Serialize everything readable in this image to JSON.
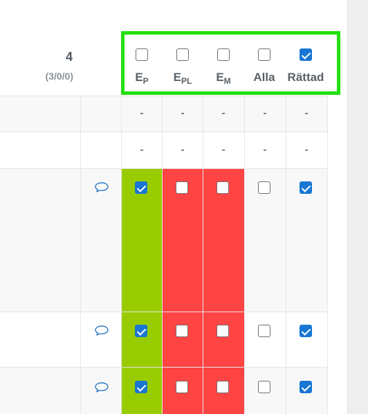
{
  "summary": {
    "count": "4",
    "detail": "(3/0/0)"
  },
  "header": {
    "columns": [
      {
        "base": "E",
        "sub": "P",
        "checked": false
      },
      {
        "base": "E",
        "sub": "PL",
        "checked": false
      },
      {
        "base": "E",
        "sub": "M",
        "checked": false
      },
      {
        "base": "Alla",
        "sub": "",
        "checked": false
      },
      {
        "base": "Rättad",
        "sub": "",
        "checked": true
      }
    ]
  },
  "dash_rows": [
    [
      "-",
      "-",
      "-",
      "-",
      "-"
    ],
    [
      "-",
      "-",
      "-",
      "-",
      "-"
    ]
  ],
  "student_rows": [
    {
      "checks": [
        true,
        false,
        false,
        false,
        true
      ]
    },
    {
      "checks": [
        true,
        false,
        false,
        false,
        true
      ]
    },
    {
      "checks": [
        true,
        false,
        false,
        false,
        true
      ]
    }
  ],
  "colors": {
    "pass": "#99cc00",
    "fail": "#ff4444",
    "accent": "#1976d2",
    "highlight": "#22e00c"
  },
  "icons": {
    "comment": "speech-bubble-icon"
  }
}
